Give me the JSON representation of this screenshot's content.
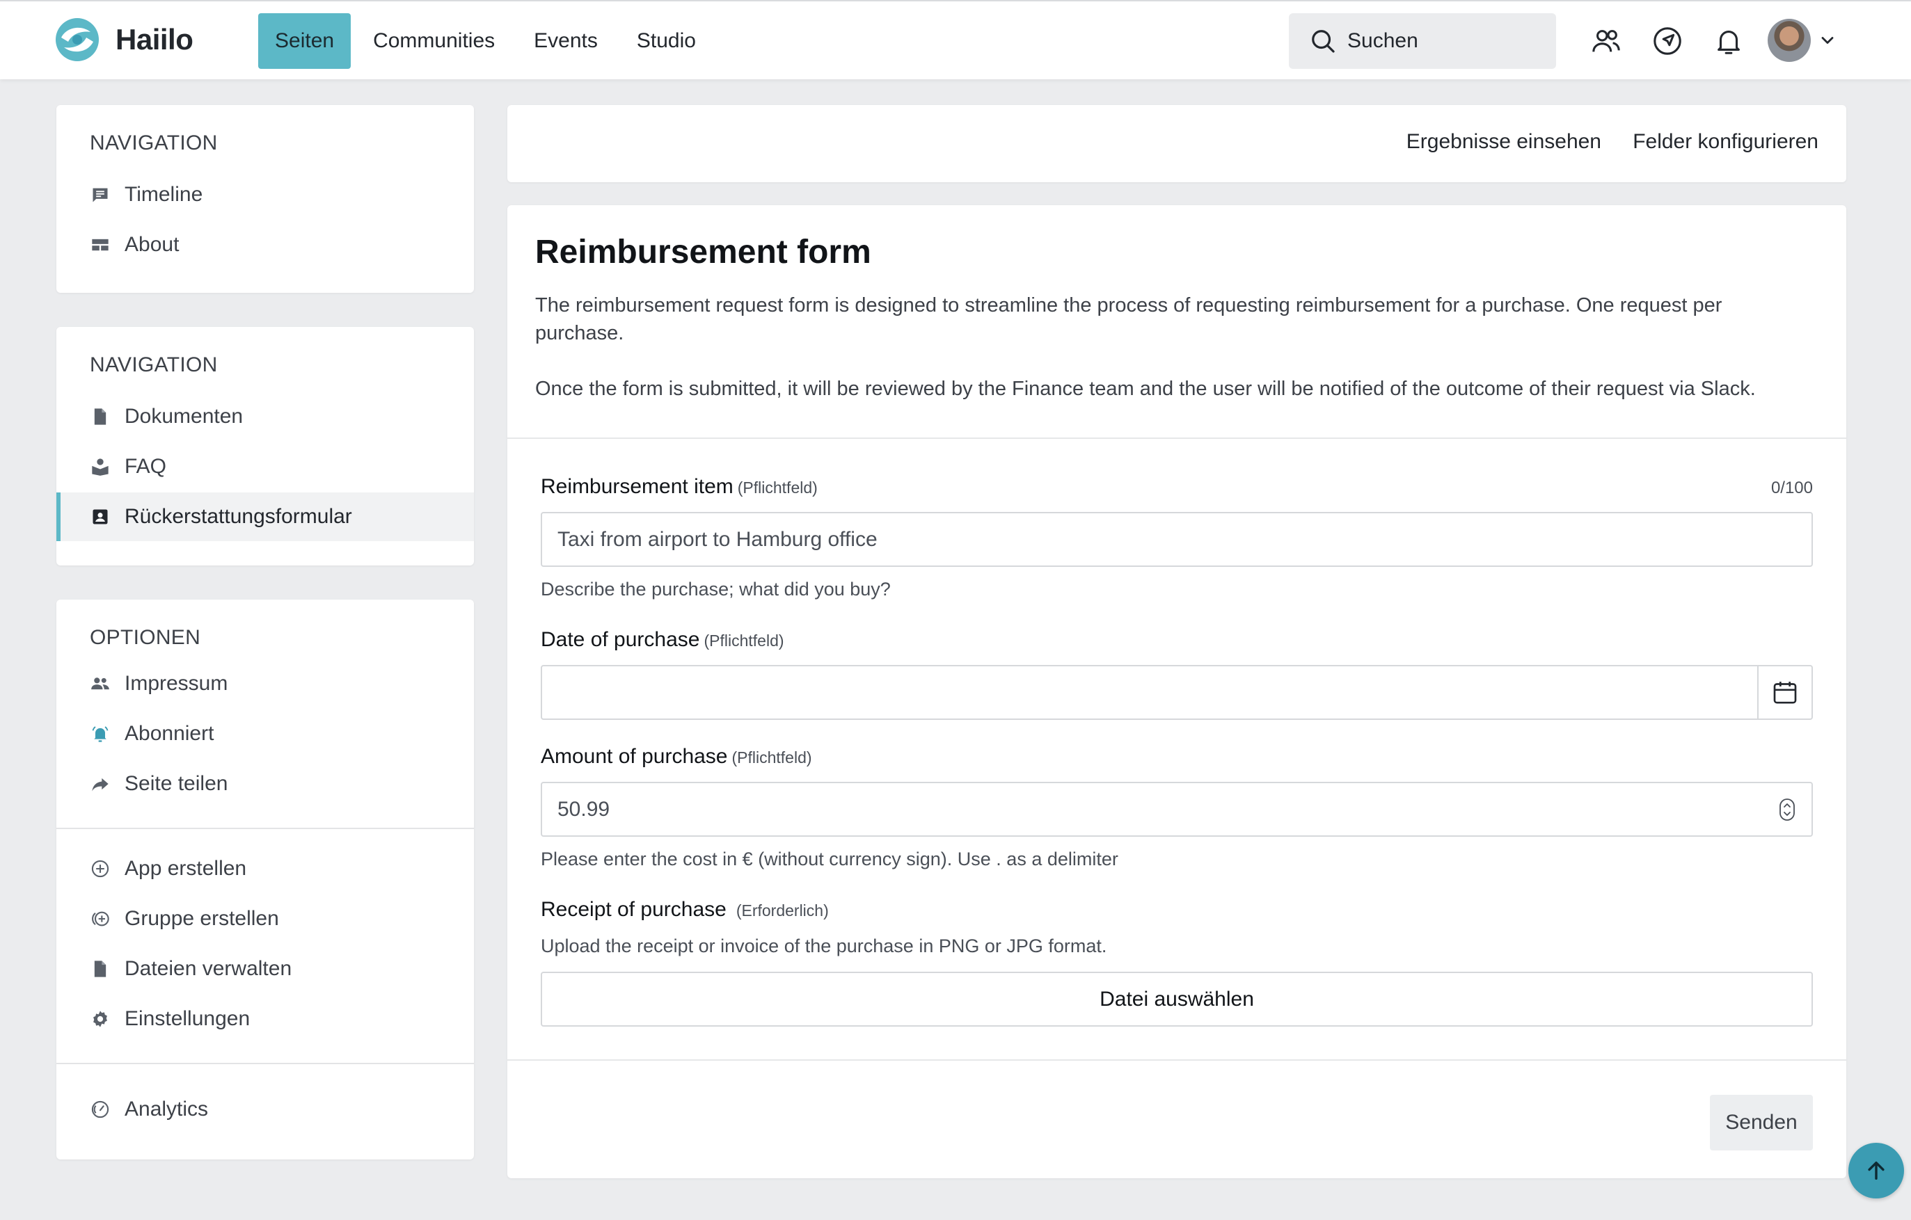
{
  "app": {
    "name": "Haiilo"
  },
  "topnav": {
    "items": [
      "Seiten",
      "Communities",
      "Events",
      "Studio"
    ],
    "active": "Seiten"
  },
  "search": {
    "placeholder": "Suchen"
  },
  "sidebar": {
    "section1": {
      "title": "NAVIGATION",
      "items": [
        "Timeline",
        "About"
      ]
    },
    "section2": {
      "title": "NAVIGATION",
      "items": [
        "Dokumenten",
        "FAQ",
        "Rückerstattungsformular"
      ],
      "active": "Rückerstattungsformular"
    },
    "section3": {
      "title": "OPTIONEN",
      "items": [
        "Impressum",
        "Abonniert",
        "Seite teilen"
      ],
      "items2": [
        "App erstellen",
        "Gruppe erstellen",
        "Dateien verwalten",
        "Einstellungen"
      ]
    },
    "analytics": "Analytics"
  },
  "actions": {
    "results": "Ergebnisse einsehen",
    "configure": "Felder konfigurieren"
  },
  "form": {
    "title": "Reimbursement form",
    "desc1": "The reimbursement request form is designed to streamline the process of requesting reimbursement for a purchase. One request per purchase.",
    "desc2": "Once the form is submitted, it will be reviewed by the Finance team and the user will be notified of the outcome of their request via Slack.",
    "item": {
      "label": "Reimbursement item",
      "required": "(Pflichtfeld)",
      "counter": "0/100",
      "placeholder": "Taxi from airport to Hamburg office",
      "hint": "Describe the purchase; what did you buy?"
    },
    "date": {
      "label": "Date of purchase",
      "required": "(Pflichtfeld)",
      "value": ""
    },
    "amount": {
      "label": "Amount of purchase",
      "required": "(Pflichtfeld)",
      "value": "50.99",
      "hint": "Please enter the cost in € (without currency sign). Use . as a delimiter"
    },
    "receipt": {
      "label": "Receipt of purchase",
      "required": "(Erforderlich)",
      "hint": "Upload the receipt or invoice of the purchase in PNG or JPG format.",
      "button": "Datei auswählen"
    },
    "submit": "Senden"
  },
  "colors": {
    "accent": "#5cb8c7",
    "fab": "#3b9cb3",
    "background": "#ebecee"
  },
  "icons": {
    "top": [
      "people-icon",
      "compass-icon",
      "bell-icon"
    ],
    "fab": "arrow-up-icon"
  }
}
